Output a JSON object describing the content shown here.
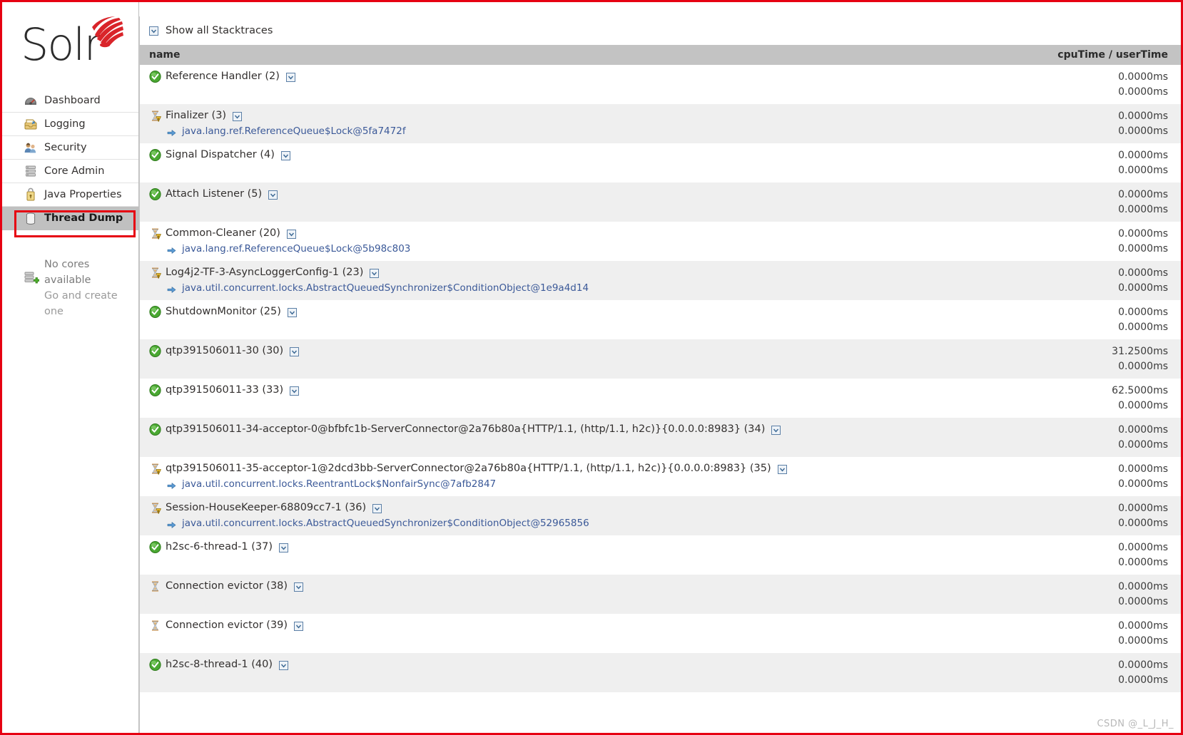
{
  "brand": {
    "name": "Solr",
    "logo_icon": "solr-burst-icon"
  },
  "sidebar": {
    "items": [
      {
        "label": "Dashboard",
        "icon": "dashboard-gauge-icon",
        "active": false
      },
      {
        "label": "Logging",
        "icon": "logging-tray-icon",
        "active": false
      },
      {
        "label": "Security",
        "icon": "security-people-icon",
        "active": false
      },
      {
        "label": "Core Admin",
        "icon": "core-admin-db-icon",
        "active": false
      },
      {
        "label": "Java Properties",
        "icon": "java-properties-icon",
        "active": false
      },
      {
        "label": "Thread Dump",
        "icon": "thread-dump-icon",
        "active": true
      }
    ],
    "cores": {
      "icon": "core-add-icon",
      "line1": "No cores available",
      "line2": "Go and create one"
    }
  },
  "main": {
    "show_all_stacktraces_label": "Show all Stacktraces",
    "show_all_stacktraces_checked": false,
    "columns": {
      "name": "name",
      "time": "cpuTime / userTime"
    },
    "threads": [
      {
        "name": "Reference Handler (2)",
        "state": "runnable",
        "cpuTime": "0.0000ms",
        "userTime": "0.0000ms",
        "lock": null
      },
      {
        "name": "Finalizer (3)",
        "state": "waiting",
        "cpuTime": "0.0000ms",
        "userTime": "0.0000ms",
        "lock": "java.lang.ref.ReferenceQueue$Lock@5fa7472f"
      },
      {
        "name": "Signal Dispatcher (4)",
        "state": "runnable",
        "cpuTime": "0.0000ms",
        "userTime": "0.0000ms",
        "lock": null
      },
      {
        "name": "Attach Listener (5)",
        "state": "runnable",
        "cpuTime": "0.0000ms",
        "userTime": "0.0000ms",
        "lock": null
      },
      {
        "name": "Common-Cleaner (20)",
        "state": "waiting",
        "cpuTime": "0.0000ms",
        "userTime": "0.0000ms",
        "lock": "java.lang.ref.ReferenceQueue$Lock@5b98c803"
      },
      {
        "name": "Log4j2-TF-3-AsyncLoggerConfig-1 (23)",
        "state": "waiting",
        "cpuTime": "0.0000ms",
        "userTime": "0.0000ms",
        "lock": "java.util.concurrent.locks.AbstractQueuedSynchronizer$ConditionObject@1e9a4d14"
      },
      {
        "name": "ShutdownMonitor (25)",
        "state": "runnable",
        "cpuTime": "0.0000ms",
        "userTime": "0.0000ms",
        "lock": null
      },
      {
        "name": "qtp391506011-30 (30)",
        "state": "runnable",
        "cpuTime": "31.2500ms",
        "userTime": "0.0000ms",
        "lock": null
      },
      {
        "name": "qtp391506011-33 (33)",
        "state": "runnable",
        "cpuTime": "62.5000ms",
        "userTime": "0.0000ms",
        "lock": null
      },
      {
        "name": "qtp391506011-34-acceptor-0@bfbfc1b-ServerConnector@2a76b80a{HTTP/1.1, (http/1.1, h2c)}{0.0.0.0:8983} (34)",
        "state": "runnable",
        "cpuTime": "0.0000ms",
        "userTime": "0.0000ms",
        "lock": null
      },
      {
        "name": "qtp391506011-35-acceptor-1@2dcd3bb-ServerConnector@2a76b80a{HTTP/1.1, (http/1.1, h2c)}{0.0.0.0:8983} (35)",
        "state": "waiting",
        "cpuTime": "0.0000ms",
        "userTime": "0.0000ms",
        "lock": "java.util.concurrent.locks.ReentrantLock$NonfairSync@7afb2847"
      },
      {
        "name": "Session-HouseKeeper-68809cc7-1 (36)",
        "state": "waiting",
        "cpuTime": "0.0000ms",
        "userTime": "0.0000ms",
        "lock": "java.util.concurrent.locks.AbstractQueuedSynchronizer$ConditionObject@52965856"
      },
      {
        "name": "h2sc-6-thread-1 (37)",
        "state": "runnable",
        "cpuTime": "0.0000ms",
        "userTime": "0.0000ms",
        "lock": null
      },
      {
        "name": "Connection evictor (38)",
        "state": "timed-waiting",
        "cpuTime": "0.0000ms",
        "userTime": "0.0000ms",
        "lock": null
      },
      {
        "name": "Connection evictor (39)",
        "state": "timed-waiting",
        "cpuTime": "0.0000ms",
        "userTime": "0.0000ms",
        "lock": null
      },
      {
        "name": "h2sc-8-thread-1 (40)",
        "state": "runnable",
        "cpuTime": "0.0000ms",
        "userTime": "0.0000ms",
        "lock": null
      }
    ]
  },
  "watermark": "CSDN @_L_J_H_",
  "colors": {
    "accent_red": "#e60012",
    "header_gray": "#c3c3c3",
    "alt_row": "#efefef",
    "link_blue": "#3b5998",
    "ok_green": "#3fa534",
    "warn_yellow": "#e8b923"
  }
}
